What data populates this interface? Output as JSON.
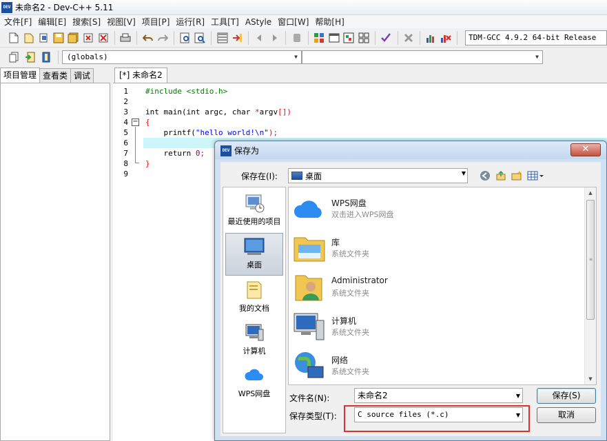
{
  "window": {
    "title": "未命名2 - Dev-C++ 5.11",
    "icon": "DEV"
  },
  "menu": [
    "文件[F]",
    "编辑[E]",
    "搜索[S]",
    "视图[V]",
    "项目[P]",
    "运行[R]",
    "工具[T]",
    "AStyle",
    "窗口[W]",
    "帮助[H]"
  ],
  "toolbar": {
    "compiler": "TDM-GCC 4.9.2 64-bit Release"
  },
  "toolbar2": {
    "scope": "(globals)",
    "members": ""
  },
  "left_panel": {
    "tabs": [
      "项目管理",
      "查看类",
      "调试"
    ]
  },
  "editor": {
    "tab": "[*] 未命名2",
    "line_numbers": [
      "1",
      "2",
      "3",
      "4",
      "5",
      "6",
      "7",
      "8",
      "9"
    ],
    "code": {
      "l1": "#include <stdio.h>",
      "l3a": "int main(int argc, char ",
      "l3b": "*",
      "l3c": "argv",
      "l3d": "[])",
      "l4": "{",
      "l5a": "    printf(",
      "l5b": "\"hello world!\\n\"",
      "l5c": ");",
      "l7a": "    return ",
      "l7b": "0",
      "l7c": ";",
      "l8": "}"
    },
    "highlight_color": "#ccf6f9"
  },
  "dialog": {
    "title": "保存为",
    "close": "✕",
    "save_in_label": "保存在(I):",
    "save_in_value": "桌面",
    "places": [
      "最近使用的项目",
      "桌面",
      "我的文档",
      "计算机",
      "WPS网盘"
    ],
    "files": [
      {
        "name": "WPS网盘",
        "desc": "双击进入WPS网盘",
        "icon": "wps-cloud-icon"
      },
      {
        "name": "库",
        "desc": "系统文件夹",
        "icon": "library-folder-icon"
      },
      {
        "name": "Administrator",
        "desc": "系统文件夹",
        "icon": "user-folder-icon"
      },
      {
        "name": "计算机",
        "desc": "系统文件夹",
        "icon": "computer-icon"
      },
      {
        "name": "网络",
        "desc": "系统文件夹",
        "icon": "network-icon"
      }
    ],
    "filename_label": "文件名(N):",
    "filename_value": "未命名2",
    "filetype_label": "保存类型(T):",
    "filetype_value": "C source files (*.c)",
    "save_button": "保存(S)",
    "cancel_button": "取消",
    "highlight_box_color": "#e0302a"
  }
}
